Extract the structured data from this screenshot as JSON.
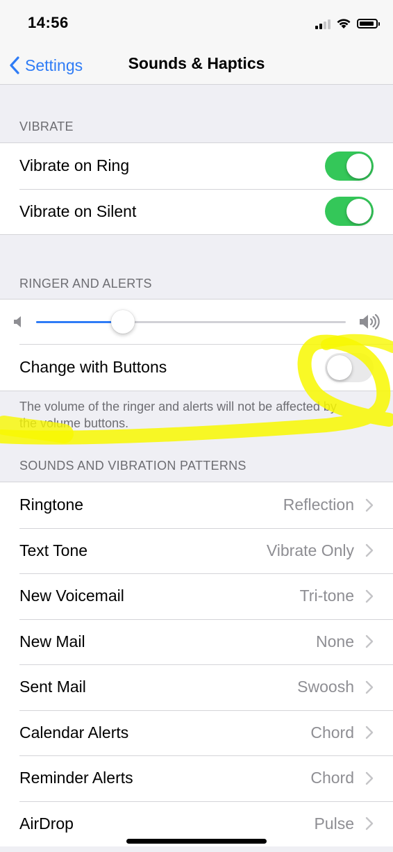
{
  "status_bar": {
    "time": "14:56",
    "icons": [
      "cellular-signal-icon",
      "wifi-icon",
      "battery-icon"
    ]
  },
  "nav": {
    "back_label": "Settings",
    "title": "Sounds & Haptics"
  },
  "vibrate": {
    "header": "VIBRATE",
    "rows": [
      {
        "label": "Vibrate on Ring",
        "on": true
      },
      {
        "label": "Vibrate on Silent",
        "on": true
      }
    ]
  },
  "ringer": {
    "header": "RINGER AND ALERTS",
    "volume_level": 0.28,
    "change_with_buttons_label": "Change with Buttons",
    "change_with_buttons_on": false,
    "footer": "The volume of the ringer and alerts will not be affected by the volume buttons."
  },
  "sounds": {
    "header": "SOUNDS AND VIBRATION PATTERNS",
    "rows": [
      {
        "label": "Ringtone",
        "value": "Reflection"
      },
      {
        "label": "Text Tone",
        "value": "Vibrate Only"
      },
      {
        "label": "New Voicemail",
        "value": "Tri-tone"
      },
      {
        "label": "New Mail",
        "value": "None"
      },
      {
        "label": "Sent Mail",
        "value": "Swoosh"
      },
      {
        "label": "Calendar Alerts",
        "value": "Chord"
      },
      {
        "label": "Reminder Alerts",
        "value": "Chord"
      },
      {
        "label": "AirDrop",
        "value": "Pulse"
      }
    ]
  },
  "colors": {
    "accent": "#2f7cf6",
    "toggle_on": "#34c759",
    "highlight_annotation": "#f8f800"
  }
}
